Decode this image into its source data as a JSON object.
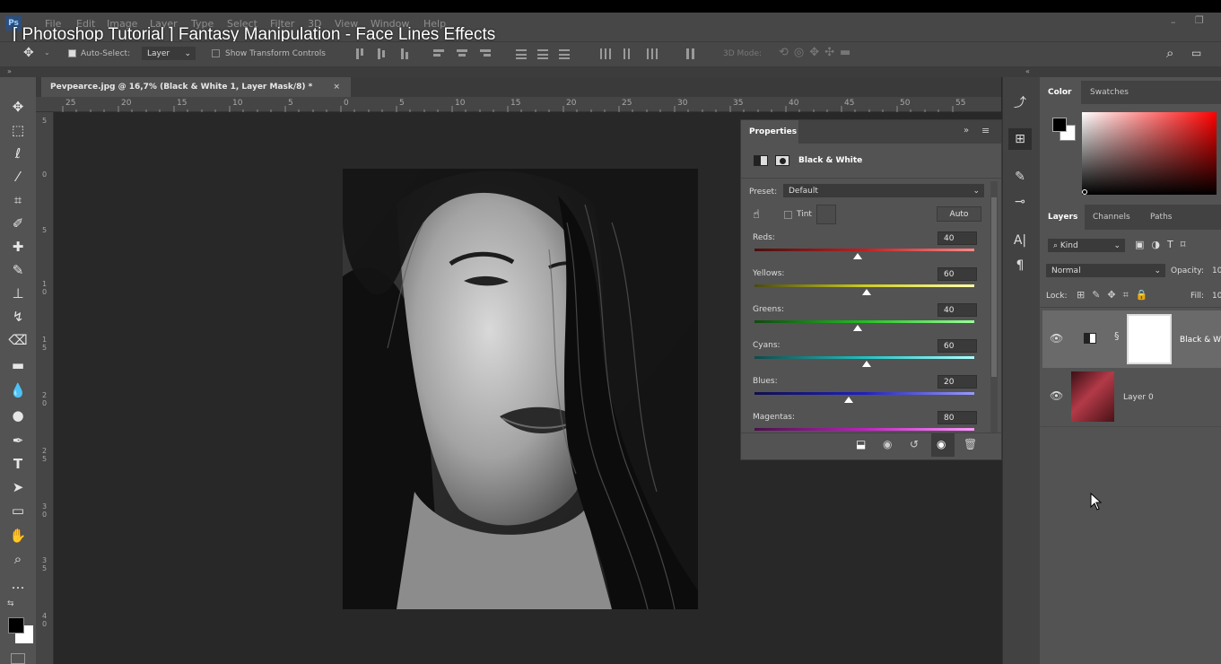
{
  "video_title": "[ Photoshop Tutorial ] Fantasy Manipulation - Face Lines Effects",
  "menu": [
    "File",
    "Edit",
    "Image",
    "Layer",
    "Type",
    "Select",
    "Filter",
    "3D",
    "View",
    "Window",
    "Help"
  ],
  "app_logo": "Ps",
  "options": {
    "auto_select_label": "Auto-Select:",
    "auto_select_value": "Layer",
    "show_transform_label": "Show Transform Controls",
    "mode_3d_label": "3D Mode:"
  },
  "doc_tab": {
    "title": "Pevpearce.jpg @ 16,7% (Black & White 1, Layer Mask/8) *",
    "close": "×"
  },
  "ruler_h": [
    "25",
    "20",
    "15",
    "10",
    "5",
    "0",
    "5",
    "10",
    "15",
    "20",
    "25",
    "30",
    "35",
    "40",
    "45",
    "50",
    "55"
  ],
  "ruler_v": [
    "5",
    "0",
    "5",
    "1 0",
    "1 5",
    "2 0",
    "2 5",
    "3 0",
    "3 5",
    "4 0"
  ],
  "properties": {
    "tab": "Properties",
    "adjustment_title": "Black & White",
    "preset_label": "Preset:",
    "preset_value": "Default",
    "tint_label": "Tint",
    "auto_label": "Auto",
    "sliders": [
      {
        "label": "Reds:",
        "value": "40",
        "position": 0.47,
        "colors": "#4a1010,#c02020,#ff8888"
      },
      {
        "label": "Yellows:",
        "value": "60",
        "position": 0.51,
        "colors": "#4a4a10,#cccc20,#ffffaa"
      },
      {
        "label": "Greens:",
        "value": "40",
        "position": 0.47,
        "colors": "#104a10,#20c020,#99ff99"
      },
      {
        "label": "Cyans:",
        "value": "60",
        "position": 0.51,
        "colors": "#104a4a,#20c0c0,#aaffff"
      },
      {
        "label": "Blues:",
        "value": "20",
        "position": 0.43,
        "colors": "#10104a,#2020c0,#9999ff"
      },
      {
        "label": "Magentas:",
        "value": "80",
        "position": 0.56,
        "colors": "#4a104a,#c020c0,#ff99ff"
      }
    ],
    "footer_icons": [
      "clip-to-layer-icon",
      "view-previous-icon",
      "reset-icon",
      "visibility-icon",
      "delete-icon"
    ]
  },
  "color_panel": {
    "tabs": [
      "Color",
      "Swatches"
    ],
    "foreground": "#000000",
    "background": "#ffffff",
    "hue": "#ff0000"
  },
  "layers_panel": {
    "tabs": [
      "Layers",
      "Channels",
      "Paths"
    ],
    "filter_label": "Kind",
    "blend_mode": "Normal",
    "opacity_label": "Opacity:",
    "opacity_value": "10",
    "lock_label": "Lock:",
    "fill_label": "Fill:",
    "fill_value": "10",
    "layers": [
      {
        "name": "Black & W",
        "type": "adjustment"
      },
      {
        "name": "Layer 0",
        "type": "image"
      }
    ]
  }
}
